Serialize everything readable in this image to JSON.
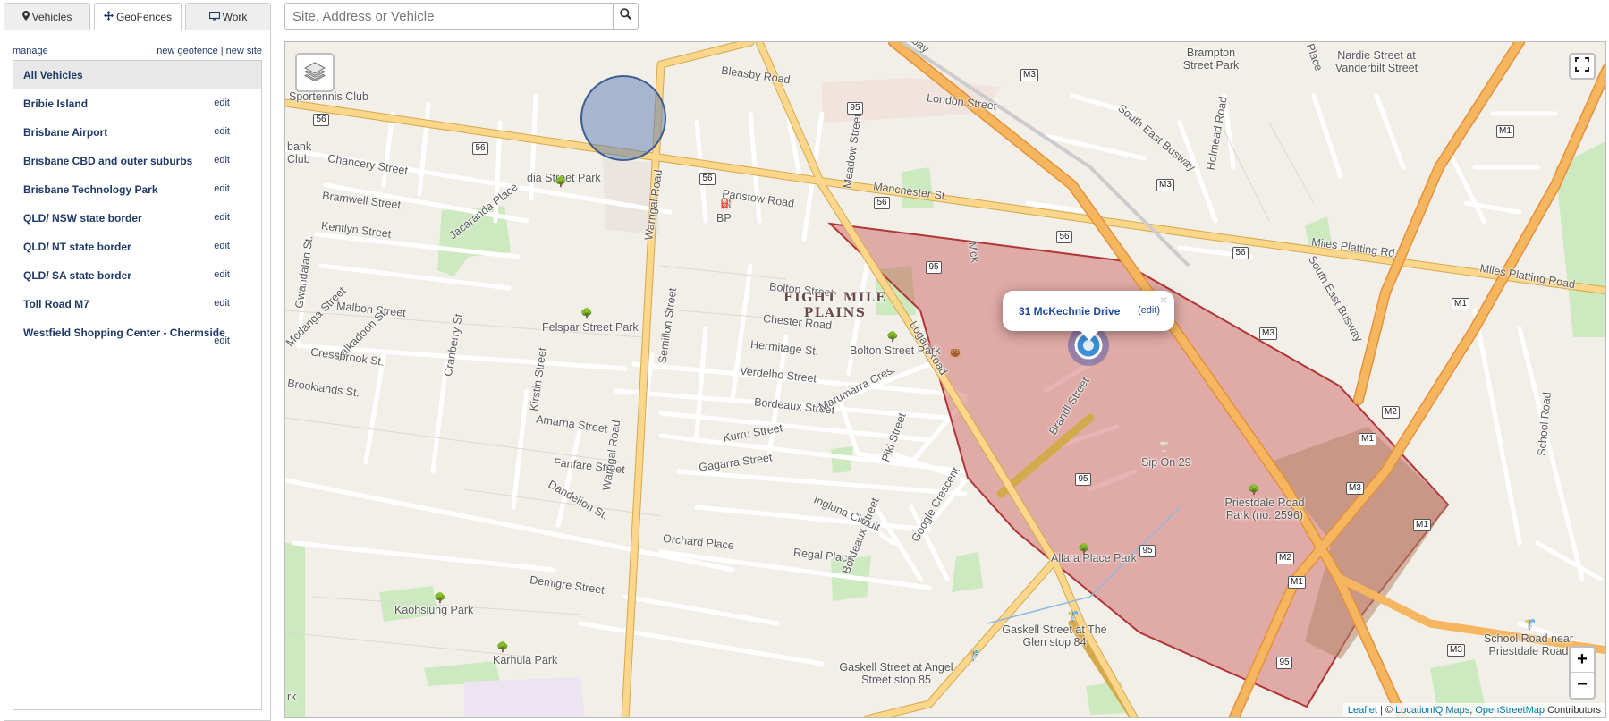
{
  "tabs": [
    {
      "label": "Vehicles",
      "icon": "map-marker-icon"
    },
    {
      "label": "GeoFences",
      "icon": "move-arrows-icon"
    },
    {
      "label": "Work",
      "icon": "monitor-icon"
    }
  ],
  "panel": {
    "manage_label": "manage",
    "new_geofence_label": "new geofence",
    "separator": "|",
    "new_site_label": "new site"
  },
  "geofences": {
    "all_label": "All Vehicles",
    "items": [
      {
        "name": "Bribie Island",
        "edit": "edit"
      },
      {
        "name": "Brisbane Airport",
        "edit": "edit"
      },
      {
        "name": "Brisbane CBD and outer suburbs",
        "edit": "edit"
      },
      {
        "name": "Brisbane Technology Park",
        "edit": "edit"
      },
      {
        "name": "QLD/ NSW state border",
        "edit": "edit"
      },
      {
        "name": "QLD/ NT state border",
        "edit": "edit"
      },
      {
        "name": "QLD/ SA state border",
        "edit": "edit"
      },
      {
        "name": "Toll Road M7",
        "edit": "edit"
      },
      {
        "name": "Westfield Shopping Center - Chermside",
        "edit": "edit"
      }
    ]
  },
  "search": {
    "placeholder": "Site, Address or Vehicle",
    "value": ""
  },
  "map": {
    "popup": {
      "title": "31 McKechnie Drive",
      "edit": "(edit)",
      "close": "×"
    },
    "suburb": {
      "line1": "EIGHT MILE",
      "line2": "PLAINS"
    },
    "streets": {
      "bleasby": "Bleasby Road",
      "london": "London Street",
      "padstow": "Padstow Road",
      "chancery": "Chancery Street",
      "bramwell": "Bramwell Street",
      "kentlyn": "Kentlyn Street",
      "jacaranda": "Jacaranda Place",
      "malbon": "Malbon Street",
      "bolton": "Bolton Street",
      "chester": "Chester Road",
      "hermitage": "Hermitage St.",
      "verdelho": "Verdelho Street",
      "bordeaux": "Bordeaux Street",
      "kurru": "Kurru Street",
      "gagarra": "Gagarra Street",
      "amarna": "Amarna Street",
      "fanfare": "Fanfare Street",
      "dandelion": "Dandelion St.",
      "orchard": "Orchard Place",
      "regal": "Regal Place",
      "demigre": "Demigre Street",
      "ingluna": "Ingluna Circuit",
      "logan": "Logan Road",
      "warrigal_n": "Warrigal Road",
      "warrigal_s": "Warrigal Road",
      "semillon": "Semillon Street",
      "kirstin": "Kirstin Street",
      "cranberry": "Cranberry St.",
      "kalkadoon": "Kalkadoon St.",
      "cressbrook": "Cressbrook St.",
      "brooklands": "Brooklands St.",
      "gwandalan": "Gwandalan St.",
      "manchester": "Manchester St.",
      "meadow": "Meadow Street",
      "marumarra": "Marumarra Cres.",
      "piki": "Piki Street",
      "google": "Google Crescent",
      "bordeaux2": "Bordeaux Street",
      "brandl": "Brandl Street",
      "mck": "Mck",
      "miles1": "Miles Platting Rd.",
      "miles2": "Miles Platting Road",
      "busway1": "South East Busway",
      "busway2": "South East Busway",
      "holmead": "Holmead Road",
      "school": "School Road",
      "place": "Place",
      "mcdanga": "Mcdanga Street",
      "jbay": "bay"
    },
    "places": {
      "sportennis": "Sportennis Club",
      "bank_club": "bank Club",
      "dia_park": "dia Street Park",
      "bp": "BP",
      "felspar": "Felspar Street Park",
      "bolton_park": "Bolton Street Park",
      "sip": "Sip On 29",
      "priestdale": "Priestdale Road Park (no. 2596)",
      "allara": "Allara Place Park",
      "kaohsiung": "Kaohsiung Park",
      "karhula": "Karhula Park",
      "gaskell_glen": "Gaskell Street at The Glen stop 84",
      "gaskell_angel": "Gaskell Street at Angel Street stop 85",
      "brampton": "Brampton Street Park",
      "nardie": "Nardie Street at Vanderbilt Street",
      "school_stop": "School Road near Priestdale Road",
      "rk": "rk"
    },
    "shields": [
      "56",
      "56",
      "56",
      "56",
      "56",
      "56",
      "95",
      "95",
      "95",
      "95",
      "95",
      "M3",
      "M3",
      "M3",
      "M3",
      "M3",
      "M1",
      "M1",
      "M1",
      "M1",
      "M1",
      "M2",
      "M2"
    ],
    "zoom_in": "+",
    "zoom_out": "−",
    "attribution": {
      "leaflet": "Leaflet",
      "sep": " | © ",
      "locationiq": "LocationIQ Maps",
      "comma": ", ",
      "osm": "OpenStreetMap",
      "contributors": " Contributors"
    },
    "colors": {
      "geofence_red": "#c84b4b",
      "geofence_blue": "#5b7eb3",
      "vehicle_marker": "#3a8fd8",
      "motorway": "#f6b65f",
      "primary_road": "#fcd68a"
    }
  }
}
